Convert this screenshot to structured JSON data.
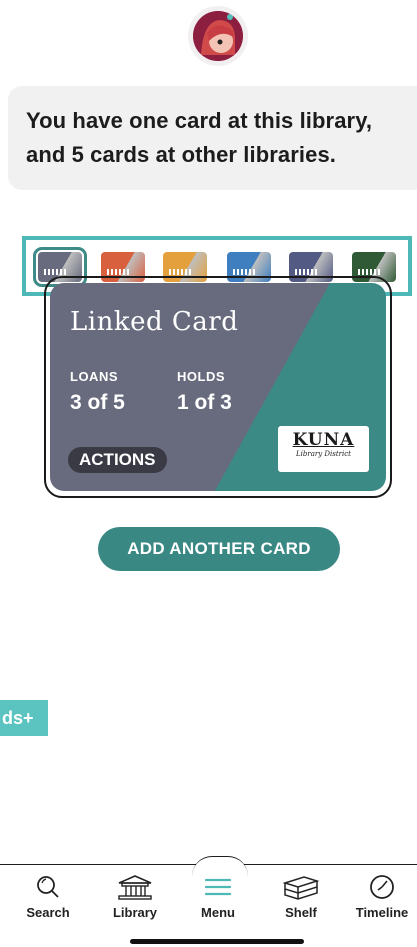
{
  "header": {
    "message": "You have one card at this library, and 5 cards at other libraries."
  },
  "card_strip": {
    "colors": [
      "#676b7d",
      "#d9603f",
      "#e3a03c",
      "#3f7fbf",
      "#535a84",
      "#2f5a35"
    ],
    "selected_index": 0
  },
  "card": {
    "title": "Linked Card",
    "loans_label": "LOANS",
    "loans_value": "3 of 5",
    "holds_label": "HOLDS",
    "holds_value": "1 of 3",
    "actions_label": "ACTIONS",
    "logo_line1": "KUNA",
    "logo_line2": "Library District",
    "colors": {
      "primary": "#676b7d",
      "accent": "#3b8a85"
    }
  },
  "add_card_label": "ADD ANOTHER CARD",
  "side_cue": {
    "label": "ds+"
  },
  "tabs": [
    {
      "label": "Search",
      "icon": "search-icon"
    },
    {
      "label": "Library",
      "icon": "library-icon"
    },
    {
      "label": "Menu",
      "icon": "menu-icon"
    },
    {
      "label": "Shelf",
      "icon": "shelf-icon"
    },
    {
      "label": "Timeline",
      "icon": "timeline-icon"
    }
  ],
  "colors": {
    "teal": "#3a8884",
    "highlight": "#4db8b6"
  }
}
